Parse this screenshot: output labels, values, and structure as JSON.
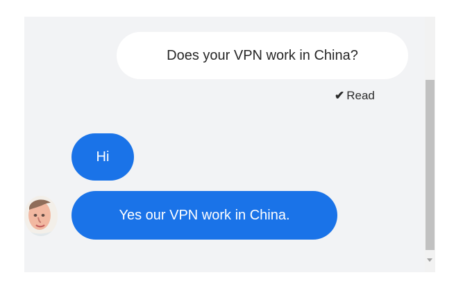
{
  "conversation": {
    "outgoing_message": "Does your VPN work in China?",
    "read_status": "Read",
    "incoming_messages": [
      "Hi",
      "Yes our VPN work in China."
    ]
  },
  "icons": {
    "read_check": "check-icon",
    "avatar": "agent-avatar"
  },
  "colors": {
    "panel_background": "#f2f3f5",
    "outgoing_bubble": "#ffffff",
    "incoming_bubble": "#1a73e8",
    "scrollbar_thumb": "#c1c1c1"
  }
}
